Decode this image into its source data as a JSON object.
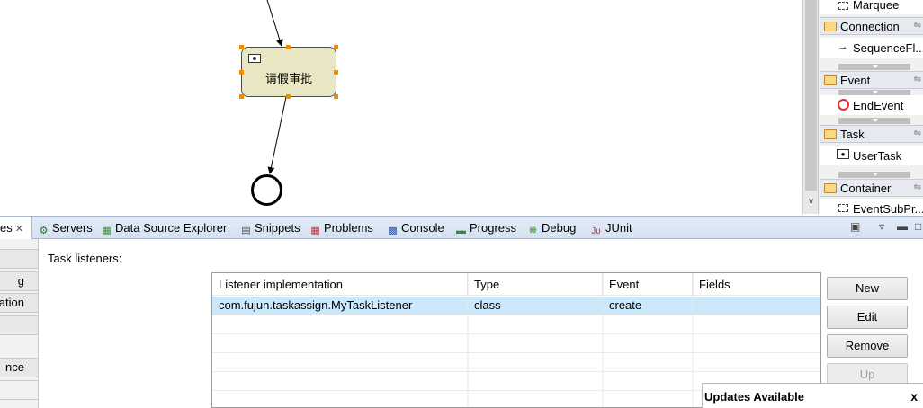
{
  "diagram": {
    "task_label": "请假审批"
  },
  "palette": {
    "marquee_label": "Marquee",
    "drawers": [
      {
        "label": "Connection",
        "items": [
          {
            "label": "SequenceFl...",
            "icon": "arrow-icon"
          }
        ]
      },
      {
        "label": "Event",
        "items": [
          {
            "label": "EndEvent",
            "icon": "end-event-icon"
          }
        ]
      },
      {
        "label": "Task",
        "items": [
          {
            "label": "UserTask",
            "icon": "user-task-icon"
          }
        ]
      },
      {
        "label": "Container",
        "items": [
          {
            "label": "EventSubPr...",
            "icon": "subprocess-icon"
          }
        ]
      }
    ],
    "colors": {
      "end_event": "#e03030",
      "folder": "#f7d98a"
    }
  },
  "tabs": {
    "active": {
      "label": "es"
    },
    "items": [
      {
        "label": "Servers",
        "icon": "servers-icon"
      },
      {
        "label": "Data Source Explorer",
        "icon": "data-source-icon"
      },
      {
        "label": "Snippets",
        "icon": "snippets-icon"
      },
      {
        "label": "Problems",
        "icon": "problems-icon"
      },
      {
        "label": "Console",
        "icon": "console-icon"
      },
      {
        "label": "Progress",
        "icon": "progress-icon"
      },
      {
        "label": "Debug",
        "icon": "debug-icon"
      },
      {
        "label": "JUnit",
        "icon": "junit-icon"
      }
    ]
  },
  "properties": {
    "left_tabs": [
      "",
      "g",
      "ation",
      "",
      "nce",
      ""
    ],
    "section_title": "Task listeners:",
    "table": {
      "columns": [
        "Listener implementation",
        "Type",
        "Event",
        "Fields"
      ],
      "rows": [
        [
          "com.fujun.taskassign.MyTaskListener",
          "class",
          "create",
          ""
        ]
      ]
    },
    "buttons": {
      "new": "New",
      "edit": "Edit",
      "remove": "Remove",
      "up": "Up"
    }
  },
  "notification": {
    "title": "Updates Available",
    "close": "x"
  }
}
